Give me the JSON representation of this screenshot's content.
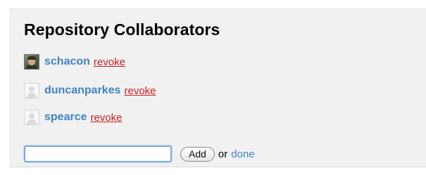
{
  "panel": {
    "title": "Repository Collaborators"
  },
  "collaborators": [
    {
      "username": "schacon",
      "revoke_label": "revoke",
      "avatar": "user-photo-icon"
    },
    {
      "username": "duncanparkes",
      "revoke_label": "revoke",
      "avatar": "default-avatar-icon"
    },
    {
      "username": "spearce",
      "revoke_label": "revoke",
      "avatar": "default-avatar-icon"
    }
  ],
  "add_form": {
    "input_value": "",
    "add_label": "Add",
    "or_text": "or",
    "done_label": "done"
  },
  "colors": {
    "panel_background": "#f1f1f1",
    "link_blue": "#4183c4",
    "revoke_red": "#cc1f1f"
  }
}
